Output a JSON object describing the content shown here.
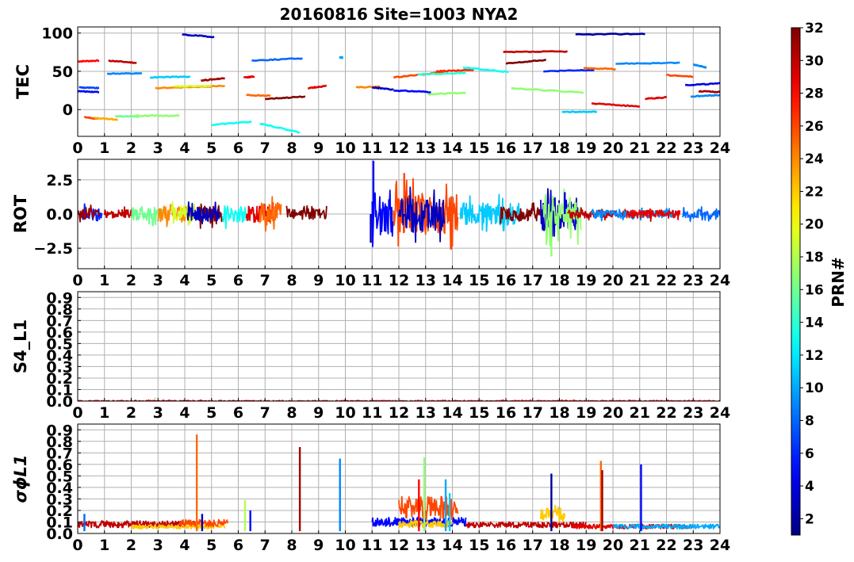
{
  "chart_data": {
    "title": "20160816 Site=1003 NYA2",
    "type": "line",
    "x_ticks": [
      "0",
      "1",
      "2",
      "3",
      "4",
      "5",
      "6",
      "7",
      "8",
      "9",
      "10",
      "11",
      "12",
      "13",
      "14",
      "15",
      "16",
      "17",
      "18",
      "19",
      "20",
      "21",
      "22",
      "23",
      "24"
    ],
    "xlim": [
      0,
      24
    ],
    "grid": true,
    "colorbar": {
      "label": "PRN#",
      "range": [
        1,
        32
      ],
      "ticks": [
        "2",
        "4",
        "6",
        "8",
        "10",
        "12",
        "14",
        "16",
        "18",
        "20",
        "22",
        "24",
        "26",
        "28",
        "30",
        "32"
      ],
      "colormap": "jet"
    },
    "panels": [
      {
        "ylabel": "TEC",
        "ylim": [
          -35,
          108
        ],
        "y_ticks": [
          {
            "v": 100,
            "t": "100"
          },
          {
            "v": 50,
            "t": "50"
          },
          {
            "v": 0,
            "t": "0"
          }
        ],
        "series": [
          {
            "prn": 28,
            "x": [
              0.0,
              0.8
            ],
            "y": [
              63,
              64
            ]
          },
          {
            "prn": 26,
            "x": [
              0.25,
              0.75
            ],
            "y": [
              -10,
              -12
            ]
          },
          {
            "prn": 7,
            "x": [
              0.05,
              0.8
            ],
            "y": [
              29,
              28
            ]
          },
          {
            "prn": 5,
            "x": [
              0.0,
              0.8
            ],
            "y": [
              24,
              23
            ]
          },
          {
            "prn": 30,
            "x": [
              1.15,
              2.2
            ],
            "y": [
              64,
              61
            ]
          },
          {
            "prn": 9,
            "x": [
              1.1,
              2.4
            ],
            "y": [
              47,
              47
            ]
          },
          {
            "prn": 23,
            "x": [
              0.6,
              1.5
            ],
            "y": [
              -11,
              -13
            ]
          },
          {
            "prn": 16,
            "x": [
              1.4,
              2.3
            ],
            "y": [
              -9,
              -9
            ]
          },
          {
            "prn": 17,
            "x": [
              2.1,
              3.8
            ],
            "y": [
              -8,
              -8
            ]
          },
          {
            "prn": 11,
            "x": [
              2.7,
              4.2
            ],
            "y": [
              42,
              43
            ]
          },
          {
            "prn": 24,
            "x": [
              2.9,
              5.5
            ],
            "y": [
              28,
              31
            ]
          },
          {
            "prn": 19,
            "x": [
              3.6,
              5.0
            ],
            "y": [
              30,
              31
            ]
          },
          {
            "prn": 3,
            "x": [
              3.9,
              5.1
            ],
            "y": [
              98,
              95
            ]
          },
          {
            "prn": 31,
            "x": [
              4.6,
              5.5
            ],
            "y": [
              38,
              41
            ]
          },
          {
            "prn": 13,
            "x": [
              5.0,
              6.5
            ],
            "y": [
              -20,
              -16
            ]
          },
          {
            "prn": 13,
            "x": [
              6.8,
              8.3
            ],
            "y": [
              -18,
              -30
            ]
          },
          {
            "prn": 29,
            "x": [
              6.2,
              6.6
            ],
            "y": [
              42,
              43
            ]
          },
          {
            "prn": 25,
            "x": [
              6.3,
              7.2
            ],
            "y": [
              19,
              18
            ]
          },
          {
            "prn": 8,
            "x": [
              6.5,
              8.4
            ],
            "y": [
              64,
              67
            ]
          },
          {
            "prn": 32,
            "x": [
              7.0,
              8.5
            ],
            "y": [
              14,
              17
            ]
          },
          {
            "prn": 29,
            "x": [
              8.6,
              9.3
            ],
            "y": [
              28,
              31
            ]
          },
          {
            "prn": 10,
            "x": [
              9.8,
              9.9
            ],
            "y": [
              68,
              68
            ]
          },
          {
            "prn": 24,
            "x": [
              10.4,
              11.3
            ],
            "y": [
              29,
              30
            ]
          },
          {
            "prn": 3,
            "x": [
              11.0,
              11.8
            ],
            "y": [
              29,
              26
            ]
          },
          {
            "prn": 5,
            "x": [
              11.8,
              13.2
            ],
            "y": [
              25,
              23
            ]
          },
          {
            "prn": 17,
            "x": [
              13.1,
              14.5
            ],
            "y": [
              20,
              22
            ]
          },
          {
            "prn": 26,
            "x": [
              11.8,
              13.7
            ],
            "y": [
              42,
              49
            ]
          },
          {
            "prn": 14,
            "x": [
              12.7,
              14.5
            ],
            "y": [
              46,
              48
            ]
          },
          {
            "prn": 27,
            "x": [
              13.4,
              14.8
            ],
            "y": [
              50,
              52
            ]
          },
          {
            "prn": 13,
            "x": [
              14.4,
              16.1
            ],
            "y": [
              55,
              49
            ]
          },
          {
            "prn": 30,
            "x": [
              15.9,
              18.3
            ],
            "y": [
              75,
              76
            ]
          },
          {
            "prn": 32,
            "x": [
              16.0,
              17.5
            ],
            "y": [
              60,
              65
            ]
          },
          {
            "prn": 17,
            "x": [
              16.2,
              18.9
            ],
            "y": [
              28,
              22
            ]
          },
          {
            "prn": 6,
            "x": [
              17.4,
              19.3
            ],
            "y": [
              50,
              52
            ]
          },
          {
            "prn": 11,
            "x": [
              18.1,
              19.4
            ],
            "y": [
              -3,
              -3
            ]
          },
          {
            "prn": 2,
            "x": [
              18.6,
              21.2
            ],
            "y": [
              98,
              99
            ]
          },
          {
            "prn": 25,
            "x": [
              18.9,
              20.1
            ],
            "y": [
              54,
              53
            ]
          },
          {
            "prn": 29,
            "x": [
              19.2,
              21.0
            ],
            "y": [
              8,
              4
            ]
          },
          {
            "prn": 9,
            "x": [
              20.1,
              22.5
            ],
            "y": [
              60,
              61
            ]
          },
          {
            "prn": 29,
            "x": [
              21.2,
              22.0
            ],
            "y": [
              14,
              16
            ]
          },
          {
            "prn": 26,
            "x": [
              22.0,
              23.0
            ],
            "y": [
              45,
              43
            ]
          },
          {
            "prn": 9,
            "x": [
              23.0,
              23.5
            ],
            "y": [
              59,
              55
            ]
          },
          {
            "prn": 4,
            "x": [
              22.7,
              24.0
            ],
            "y": [
              32,
              34
            ]
          },
          {
            "prn": 9,
            "x": [
              22.9,
              24.0
            ],
            "y": [
              17,
              19
            ]
          },
          {
            "prn": 31,
            "x": [
              23.2,
              24.0
            ],
            "y": [
              24,
              23
            ]
          }
        ]
      },
      {
        "ylabel": "ROT",
        "ylim": [
          -4,
          4
        ],
        "y_ticks": [
          {
            "v": 2.5,
            "t": "2.5"
          },
          {
            "v": 0,
            "t": "0.0"
          },
          {
            "v": -2.5,
            "t": "−2.5"
          }
        ],
        "series": [
          {
            "prn": 6,
            "x0": 0.1,
            "x1": 0.9,
            "amp": 0.5
          },
          {
            "prn": 31,
            "x0": 0.0,
            "x1": 0.8,
            "amp": 0.4
          },
          {
            "prn": 30,
            "x0": 1.0,
            "x1": 2.1,
            "amp": 0.3
          },
          {
            "prn": 16,
            "x0": 2.0,
            "x1": 3.2,
            "amp": 0.5
          },
          {
            "prn": 24,
            "x0": 3.0,
            "x1": 4.2,
            "amp": 0.6
          },
          {
            "prn": 19,
            "x0": 3.5,
            "x1": 4.4,
            "amp": 0.7
          },
          {
            "prn": 32,
            "x0": 4.5,
            "x1": 5.4,
            "amp": 0.6
          },
          {
            "prn": 3,
            "x0": 4.1,
            "x1": 5.3,
            "amp": 0.5
          },
          {
            "prn": 13,
            "x0": 5.4,
            "x1": 6.3,
            "amp": 0.6
          },
          {
            "prn": 29,
            "x0": 6.3,
            "x1": 7.3,
            "amp": 0.6
          },
          {
            "prn": 25,
            "x0": 6.8,
            "x1": 7.6,
            "amp": 0.8
          },
          {
            "prn": 32,
            "x0": 7.8,
            "x1": 9.3,
            "amp": 0.4
          },
          {
            "prn": 5,
            "x0": 11.0,
            "x1": 11.8,
            "amp": 1.8
          },
          {
            "prn": 26,
            "x0": 11.8,
            "x1": 14.2,
            "amp": 1.5
          },
          {
            "prn": 3,
            "x0": 12.0,
            "x1": 13.7,
            "amp": 1.2
          },
          {
            "prn": 11,
            "x0": 14.3,
            "x1": 16.5,
            "amp": 0.8
          },
          {
            "prn": 32,
            "x0": 15.8,
            "x1": 17.3,
            "amp": 0.5
          },
          {
            "prn": 3,
            "x0": 17.3,
            "x1": 18.7,
            "amp": 1.2
          },
          {
            "prn": 17,
            "x0": 17.4,
            "x1": 18.8,
            "amp": 1.3
          },
          {
            "prn": 30,
            "x0": 18.3,
            "x1": 20.5,
            "amp": 0.3
          },
          {
            "prn": 9,
            "x0": 19.2,
            "x1": 22.3,
            "amp": 0.3
          },
          {
            "prn": 29,
            "x0": 20.5,
            "x1": 22.5,
            "amp": 0.3
          },
          {
            "prn": 8,
            "x0": 22.6,
            "x1": 24.0,
            "amp": 0.3
          }
        ],
        "spikes": [
          {
            "prn": 5,
            "x": 11.05,
            "y": 3.9
          },
          {
            "prn": 3,
            "x": 10.95,
            "y": -2.1
          },
          {
            "prn": 26,
            "x": 12.2,
            "y": 3.0
          },
          {
            "prn": 26,
            "x": 13.95,
            "y": -2.6
          },
          {
            "prn": 17,
            "x": 17.7,
            "y": -3.1
          },
          {
            "prn": 4,
            "x": 18.2,
            "y": 1.6
          }
        ]
      },
      {
        "ylabel": "S4_L1",
        "ylim": [
          0,
          0.95
        ],
        "y_ticks": [
          {
            "v": 0.9,
            "t": "0.9"
          },
          {
            "v": 0.8,
            "t": "0.8"
          },
          {
            "v": 0.7,
            "t": "0.7"
          },
          {
            "v": 0.6,
            "t": "0.6"
          },
          {
            "v": 0.5,
            "t": "0.5"
          },
          {
            "v": 0.4,
            "t": "0.4"
          },
          {
            "v": 0.3,
            "t": "0.3"
          },
          {
            "v": 0.2,
            "t": "0.2"
          },
          {
            "v": 0.1,
            "t": "0.1"
          },
          {
            "v": 0.0,
            "t": "0.0"
          }
        ],
        "series": [
          {
            "prn": 29,
            "x0": 0.0,
            "x1": 11.0,
            "amp": 0.005
          },
          {
            "prn": 28,
            "x0": 11.0,
            "x1": 24.0,
            "amp": 0.005
          }
        ],
        "spikes": [
          {
            "prn": 17,
            "x": 2.9,
            "y": 0.03
          },
          {
            "prn": 17,
            "x": 23.3,
            "y": 0.02
          }
        ]
      },
      {
        "ylabel": "σϕL1",
        "ylim": [
          0,
          0.95
        ],
        "y_ticks": [
          {
            "v": 0.9,
            "t": "0.9"
          },
          {
            "v": 0.8,
            "t": "0.8"
          },
          {
            "v": 0.7,
            "t": "0.7"
          },
          {
            "v": 0.6,
            "t": "0.6"
          },
          {
            "v": 0.5,
            "t": "0.5"
          },
          {
            "v": 0.4,
            "t": "0.4"
          },
          {
            "v": 0.3,
            "t": "0.3"
          },
          {
            "v": 0.2,
            "t": "0.2"
          },
          {
            "v": 0.1,
            "t": "0.1"
          },
          {
            "v": 0.0,
            "t": "0.0"
          }
        ],
        "series": [
          {
            "prn": 30,
            "x0": 0.0,
            "x1": 4.5,
            "amp": 0.06,
            "base": 0.05
          },
          {
            "prn": 22,
            "x0": 2.0,
            "x1": 5.5,
            "amp": 0.04,
            "base": 0.04
          },
          {
            "prn": 26,
            "x0": 3.8,
            "x1": 5.6,
            "amp": 0.06,
            "base": 0.06
          },
          {
            "prn": 5,
            "x0": 11.0,
            "x1": 14.5,
            "amp": 0.08,
            "base": 0.06
          },
          {
            "prn": 26,
            "x0": 12.0,
            "x1": 14.2,
            "amp": 0.2,
            "base": 0.12
          },
          {
            "prn": 22,
            "x0": 12.0,
            "x1": 14.0,
            "amp": 0.06,
            "base": 0.05
          },
          {
            "prn": 30,
            "x0": 14.5,
            "x1": 19.0,
            "amp": 0.05,
            "base": 0.05
          },
          {
            "prn": 22,
            "x0": 17.3,
            "x1": 18.2,
            "amp": 0.15,
            "base": 0.1
          },
          {
            "prn": 29,
            "x0": 18.5,
            "x1": 23.0,
            "amp": 0.04,
            "base": 0.04
          },
          {
            "prn": 10,
            "x0": 20.0,
            "x1": 24.0,
            "amp": 0.04,
            "base": 0.04
          }
        ],
        "spikes": [
          {
            "prn": 8,
            "x": 0.25,
            "y": 0.17
          },
          {
            "prn": 25,
            "x": 4.45,
            "y": 0.86
          },
          {
            "prn": 3,
            "x": 4.65,
            "y": 0.17
          },
          {
            "prn": 18,
            "x": 6.25,
            "y": 0.29
          },
          {
            "prn": 5,
            "x": 6.45,
            "y": 0.2
          },
          {
            "prn": 31,
            "x": 8.3,
            "y": 0.75
          },
          {
            "prn": 9,
            "x": 9.8,
            "y": 0.65
          },
          {
            "prn": 28,
            "x": 12.75,
            "y": 0.47
          },
          {
            "prn": 17,
            "x": 12.95,
            "y": 0.66
          },
          {
            "prn": 10,
            "x": 13.75,
            "y": 0.47
          },
          {
            "prn": 11,
            "x": 13.9,
            "y": 0.35
          },
          {
            "prn": 2,
            "x": 17.7,
            "y": 0.52
          },
          {
            "prn": 25,
            "x": 19.55,
            "y": 0.63
          },
          {
            "prn": 31,
            "x": 19.6,
            "y": 0.55
          },
          {
            "prn": 5,
            "x": 21.05,
            "y": 0.6
          }
        ]
      }
    ]
  }
}
